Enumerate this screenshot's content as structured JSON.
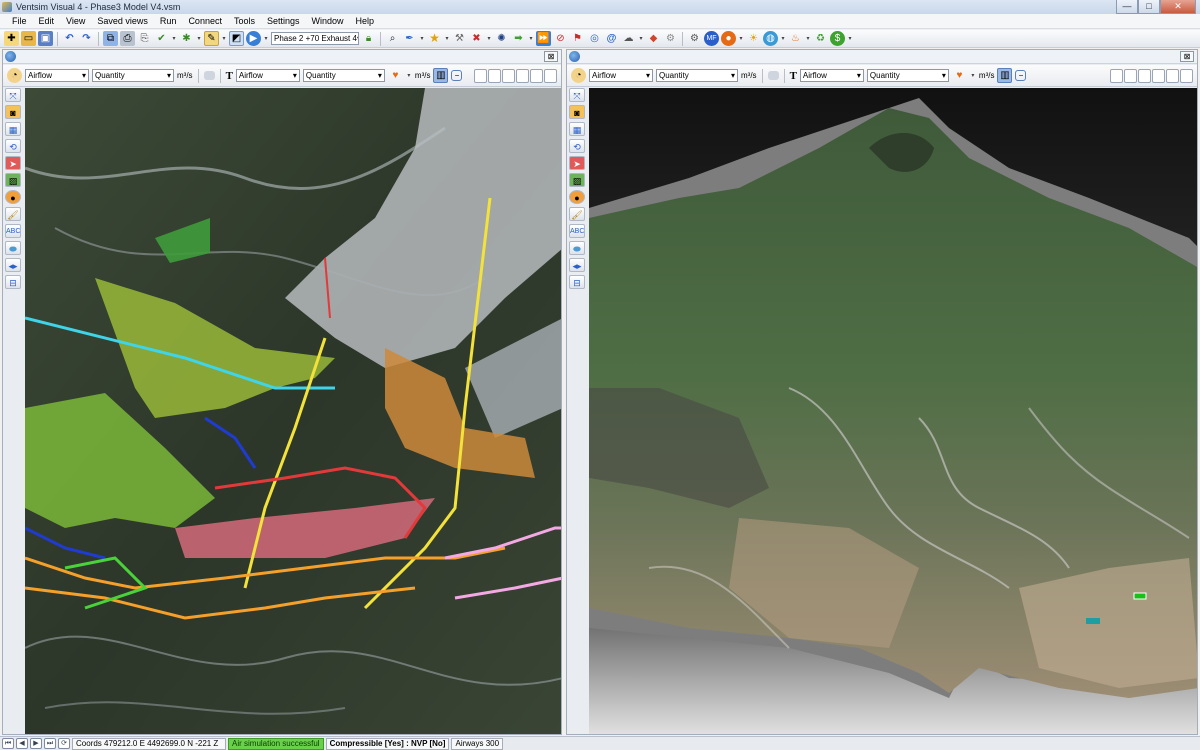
{
  "window": {
    "title": "Ventsim Visual 4  -  Phase3 Model V4.vsm",
    "controls": {
      "minimize": "—",
      "maximize": "□",
      "close": "✕"
    }
  },
  "menu": [
    "File",
    "Edit",
    "View",
    "Saved views",
    "Run",
    "Connect",
    "Tools",
    "Settings",
    "Window",
    "Help"
  ],
  "toolbar": {
    "phase_select": "Phase 2 +70 Exhaust 4",
    "drop_glyph": "▾"
  },
  "left_view": {
    "param1": "Airflow",
    "param2": "Quantity",
    "unit1": "m³/s",
    "text_param1": "Airflow",
    "text_param2": "Quantity",
    "unit2": "m³/s",
    "close_label": "⊠"
  },
  "right_view": {
    "param1": "Airflow",
    "param2": "Quantity",
    "unit1": "m³/s",
    "text_param1": "Airflow",
    "text_param2": "Quantity",
    "unit2": "m³/s",
    "close_label": "⊠"
  },
  "status": {
    "coords": "Coords 479212.0 E    4492699.0 N    -221 Z",
    "simulation": "Air simulation successful",
    "compressible": "Compressible [Yes] : NVP [No]",
    "airways": "Airways 300"
  },
  "colors": {
    "airway_yellow": "#f2e23a",
    "airway_orange": "#f5a02a",
    "airway_cyan": "#3fd4e8",
    "airway_blue": "#1f3bd0",
    "airway_green": "#4ad23b",
    "airway_pink": "#f4a8e4",
    "airway_red": "#e23a3a",
    "status_ok": "#69d04a"
  }
}
